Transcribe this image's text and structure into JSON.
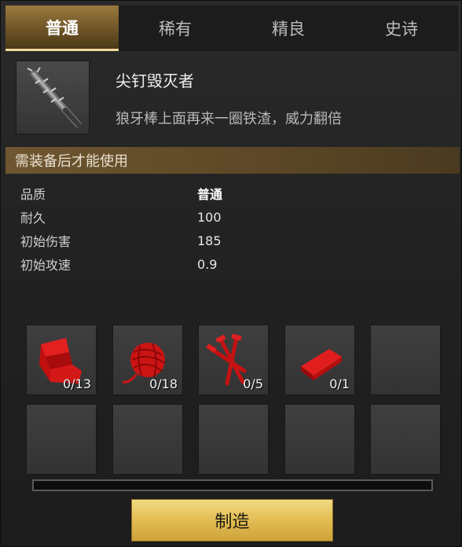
{
  "tabs": [
    {
      "label": "普通",
      "active": true
    },
    {
      "label": "稀有",
      "active": false
    },
    {
      "label": "精良",
      "active": false
    },
    {
      "label": "史诗",
      "active": false
    }
  ],
  "item": {
    "icon": "spiked-club-icon",
    "name": "尖钉毁灭者",
    "description": "狼牙棒上面再来一圈铁渣，威力翻倍"
  },
  "requirement": "需装备后才能使用",
  "stats": [
    {
      "label": "品质",
      "value": "普通"
    },
    {
      "label": "耐久",
      "value": "100"
    },
    {
      "label": "初始伤害",
      "value": "185"
    },
    {
      "label": "初始攻速",
      "value": "0.9"
    }
  ],
  "materials": [
    {
      "icon": "red-cloth-icon",
      "count": "0/13"
    },
    {
      "icon": "red-yarn-ball-icon",
      "count": "0/18"
    },
    {
      "icon": "red-nails-icon",
      "count": "0/5"
    },
    {
      "icon": "red-ingot-icon",
      "count": "0/1"
    }
  ],
  "progress": {
    "fraction": 0
  },
  "craft_button": "制造",
  "colors": {
    "accent": "#c9a64a",
    "material_red": "#d01818",
    "tab_active": "#7a5e2d"
  }
}
